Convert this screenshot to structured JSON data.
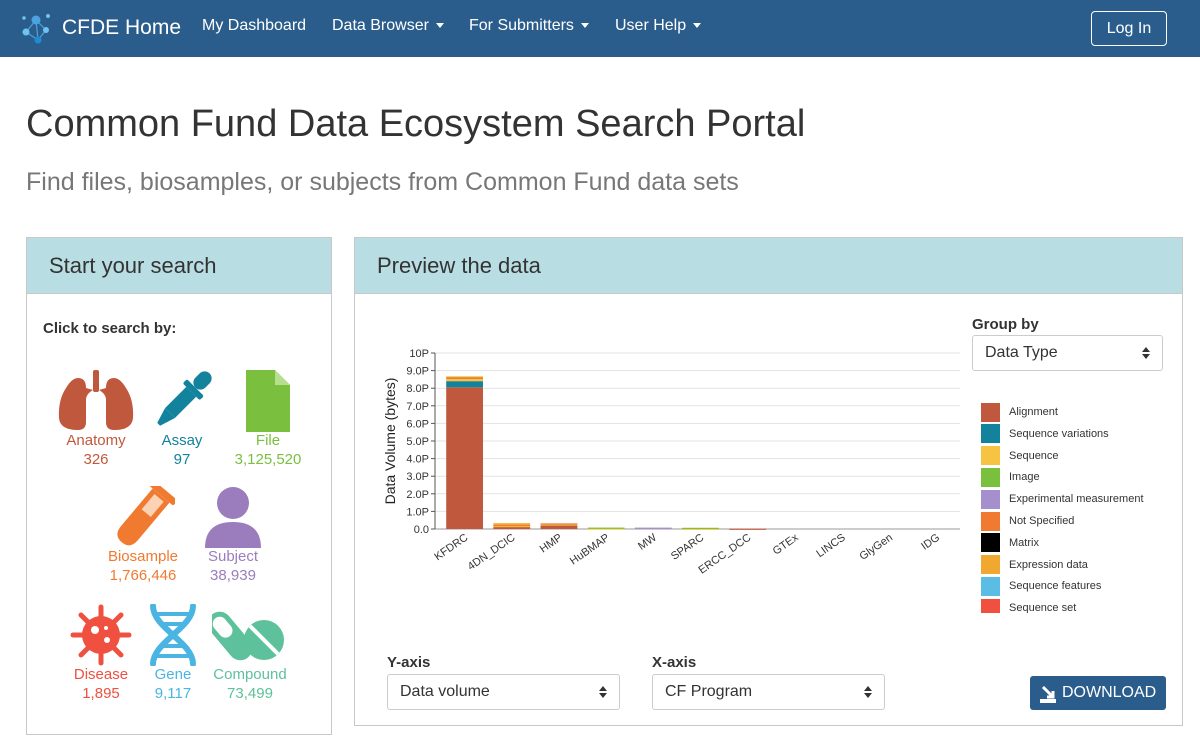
{
  "nav": {
    "brand": "CFDE Home",
    "items": [
      {
        "label": "My Dashboard",
        "dropdown": false
      },
      {
        "label": "Data Browser",
        "dropdown": true
      },
      {
        "label": "For Submitters",
        "dropdown": true
      },
      {
        "label": "User Help",
        "dropdown": true
      }
    ],
    "login": "Log In"
  },
  "page": {
    "title": "Common Fund Data Ecosystem Search Portal",
    "subtitle": "Find files, biosamples, or subjects from Common Fund data sets"
  },
  "search_panel": {
    "heading": "Start your search",
    "prompt": "Click to search by:",
    "tiles": [
      {
        "label": "Anatomy",
        "count": "326",
        "icon": "lungs-icon",
        "color": "#c0583d"
      },
      {
        "label": "Assay",
        "count": "97",
        "icon": "dropper-icon",
        "color": "#13829c"
      },
      {
        "label": "File",
        "count": "3,125,520",
        "icon": "file-icon",
        "color": "#7bbf3f"
      },
      {
        "label": "Biosample",
        "count": "1,766,446",
        "icon": "test-tube-icon",
        "color": "#f07a30"
      },
      {
        "label": "Subject",
        "count": "38,939",
        "icon": "user-icon",
        "color": "#9b7dbd"
      },
      {
        "label": "Disease",
        "count": "1,895",
        "icon": "virus-icon",
        "color": "#ef5040"
      },
      {
        "label": "Gene",
        "count": "9,117",
        "icon": "dna-icon",
        "color": "#4ab5e3"
      },
      {
        "label": "Compound",
        "count": "73,499",
        "icon": "pills-icon",
        "color": "#5dc19b"
      }
    ]
  },
  "preview_panel": {
    "heading": "Preview the data",
    "group_by_label": "Group by",
    "group_by_value": "Data Type",
    "y_axis_label": "Y-axis",
    "y_axis_value": "Data volume",
    "x_axis_label": "X-axis",
    "x_axis_value": "CF Program",
    "download": "DOWNLOAD"
  },
  "chart_data": {
    "type": "bar",
    "stacked": true,
    "ylabel": "Data Volume (bytes)",
    "ylim": [
      0,
      10
    ],
    "y_ticks": [
      "0.0",
      "1.0P",
      "2.0P",
      "3.0P",
      "4.0P",
      "5.0P",
      "6.0P",
      "7.0P",
      "8.0P",
      "9.0P",
      "10P"
    ],
    "categories": [
      "KFDRC",
      "4DN_DCIC",
      "HMP",
      "HuBMAP",
      "MW",
      "SPARC",
      "ERCC_DCC",
      "GTEx",
      "LINCS",
      "GlyGen",
      "IDG"
    ],
    "series": [
      {
        "name": "Alignment",
        "color": "#c0583d",
        "values": [
          8.05,
          0.12,
          0.22,
          0,
          0,
          0,
          0.02,
          0,
          0,
          0,
          0
        ]
      },
      {
        "name": "Sequence variations",
        "color": "#13829c",
        "values": [
          0.35,
          0,
          0,
          0,
          0,
          0,
          0,
          0,
          0,
          0,
          0
        ]
      },
      {
        "name": "Sequence",
        "color": "#f6c342",
        "values": [
          0.12,
          0.05,
          0.04,
          0.03,
          0,
          0.02,
          0,
          0,
          0,
          0,
          0
        ]
      },
      {
        "name": "Image",
        "color": "#7bbf3f",
        "values": [
          0,
          0,
          0,
          0.05,
          0,
          0.05,
          0,
          0,
          0,
          0,
          0
        ]
      },
      {
        "name": "Experimental measurement",
        "color": "#a58fcc",
        "values": [
          0,
          0,
          0,
          0,
          0.08,
          0,
          0,
          0,
          0,
          0,
          0
        ]
      },
      {
        "name": "Not Specified",
        "color": "#f07a30",
        "values": [
          0.1,
          0.06,
          0.06,
          0,
          0,
          0,
          0,
          0,
          0,
          0,
          0
        ]
      },
      {
        "name": "Matrix",
        "color": "#000000",
        "values": [
          0,
          0,
          0,
          0,
          0,
          0,
          0,
          0,
          0,
          0,
          0
        ]
      },
      {
        "name": "Expression data",
        "color": "#f0a830",
        "values": [
          0.05,
          0.1,
          0,
          0,
          0,
          0,
          0,
          0,
          0,
          0,
          0
        ]
      },
      {
        "name": "Sequence features",
        "color": "#5bbde3",
        "values": [
          0,
          0,
          0,
          0,
          0,
          0,
          0,
          0,
          0,
          0,
          0
        ]
      },
      {
        "name": "Sequence set",
        "color": "#ef5040",
        "values": [
          0,
          0,
          0,
          0,
          0,
          0,
          0,
          0,
          0,
          0,
          0
        ]
      }
    ],
    "legend": "right",
    "grid": true
  }
}
